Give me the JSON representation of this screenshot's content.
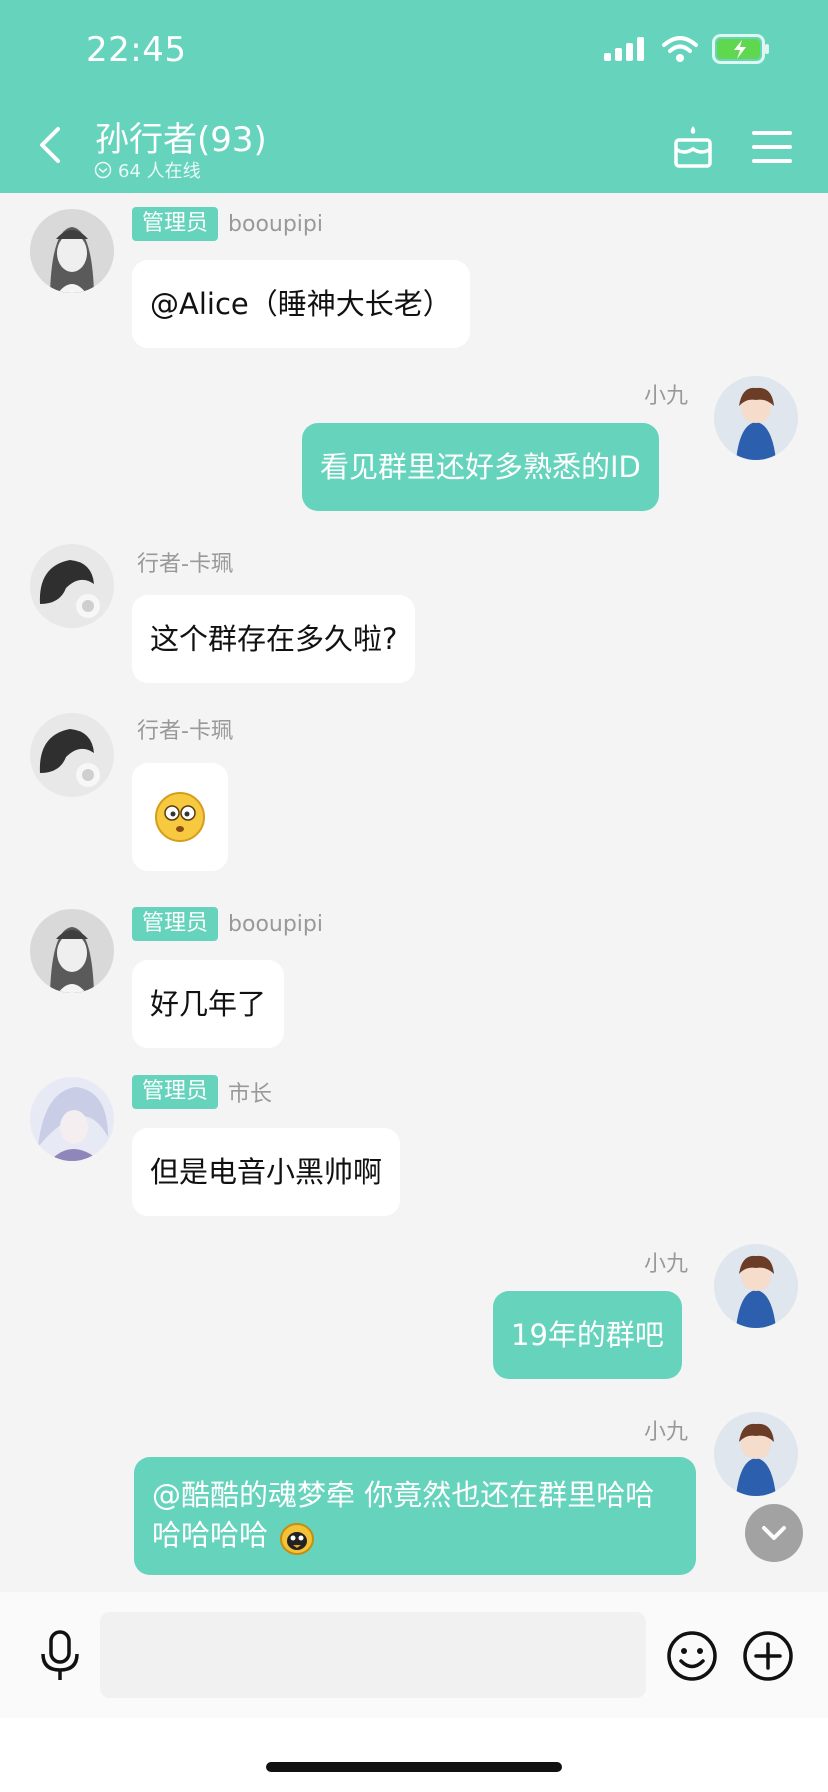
{
  "status_bar": {
    "time": "22:45"
  },
  "header": {
    "title": "孙行者(93)",
    "online_text": "64 人在线"
  },
  "badge_label": "管理员",
  "messages": [
    {
      "sender": "booupipi",
      "admin": true,
      "side": "left",
      "text": "@Alice（睡神大长老）"
    },
    {
      "sender": "小九",
      "admin": false,
      "side": "right",
      "text": "看见群里还好多熟悉的ID"
    },
    {
      "sender": "行者-卡珮",
      "admin": false,
      "side": "left",
      "text": "这个群存在多久啦?"
    },
    {
      "sender": "行者-卡珮",
      "admin": false,
      "side": "left",
      "text": "",
      "emoji": "dizzy-face-emoji"
    },
    {
      "sender": "booupipi",
      "admin": true,
      "side": "left",
      "text": "好几年了"
    },
    {
      "sender": "市长",
      "admin": true,
      "side": "left",
      "text": "但是电音小黑帅啊"
    },
    {
      "sender": "小九",
      "admin": false,
      "side": "right",
      "text": "19年的群吧"
    },
    {
      "sender": "小九",
      "admin": false,
      "side": "right",
      "text": "@酷酷的魂梦牵 你竟然也还在群里哈哈哈哈哈哈"
    }
  ],
  "colors": {
    "accent": "#66d3bd",
    "background": "#f4f4f4",
    "incoming_bubble": "#ffffff"
  }
}
